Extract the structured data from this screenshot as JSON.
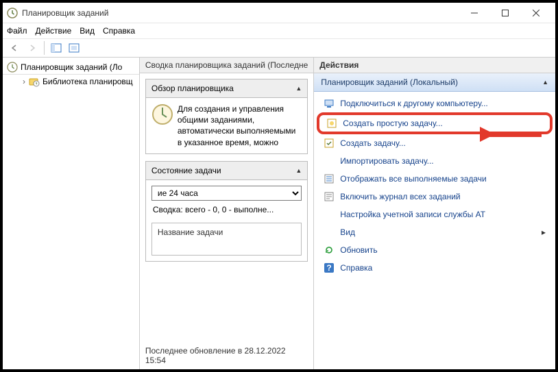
{
  "title": "Планировщик заданий",
  "menubar": {
    "file": "Файл",
    "action": "Действие",
    "view": "Вид",
    "help": "Справка"
  },
  "tree": {
    "root": "Планировщик заданий (Ло",
    "child": "Библиотека планировщ"
  },
  "middle": {
    "header": "Сводка планировщика заданий (Последнe",
    "overview_title": "Обзор планировщика",
    "overview_text": "Для создания и управления общими заданиями, автоматически выполняемыми в указанное время, можно",
    "status_title": "Состояние задачи",
    "combo_value": "ие 24 часа",
    "summary": "Сводка: всего - 0, 0 - выполне...",
    "task_name_label": "Название задачи",
    "footer": "Последнее обновление в 28.12.2022 15:54"
  },
  "actions": {
    "header": "Действия",
    "scope": "Планировщик заданий (Локальный)",
    "items": [
      "Подключиться к другому компьютеру...",
      "Создать простую задачу...",
      "Создать задачу...",
      "Импортировать задачу...",
      "Отображать все выполняемые задачи",
      "Включить журнал всех заданий",
      "Настройка учетной записи службы AT",
      "Вид",
      "Обновить",
      "Справка"
    ]
  }
}
